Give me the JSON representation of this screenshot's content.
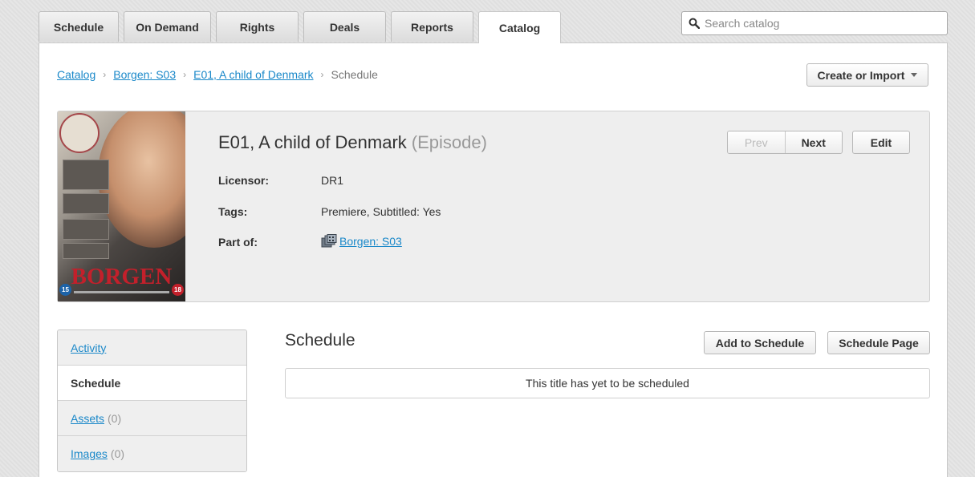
{
  "nav": {
    "tabs": [
      "Schedule",
      "On Demand",
      "Rights",
      "Deals",
      "Reports",
      "Catalog"
    ],
    "active_tab": "Catalog",
    "search_placeholder": "Search catalog"
  },
  "breadcrumb": {
    "items": [
      "Catalog",
      "Borgen: S03",
      "E01, A child of Denmark"
    ],
    "current": "Schedule",
    "separator": "›"
  },
  "toolbar": {
    "create_import_label": "Create or Import"
  },
  "title": {
    "name": "E01, A child of Denmark",
    "kind": "(Episode)",
    "prev_label": "Prev",
    "next_label": "Next",
    "edit_label": "Edit"
  },
  "poster": {
    "logo_text": "BORGEN",
    "rating_left": "15",
    "rating_right": "18"
  },
  "details": {
    "licensor_label": "Licensor:",
    "licensor_value": "DR1",
    "tags_label": "Tags:",
    "tags_value": "Premiere, Subtitled: Yes",
    "part_of_label": "Part of:",
    "part_of_value": "Borgen: S03",
    "part_of_icon": "series-icon"
  },
  "side_menu": {
    "activity": "Activity",
    "schedule": "Schedule",
    "assets": "Assets",
    "assets_count": "(0)",
    "images": "Images",
    "images_count": "(0)"
  },
  "schedule": {
    "heading": "Schedule",
    "add_label": "Add to Schedule",
    "page_label": "Schedule Page",
    "empty_message": "This title has yet to be scheduled"
  },
  "colors": {
    "link": "#1a88c9",
    "accent_red": "#c3202b"
  }
}
